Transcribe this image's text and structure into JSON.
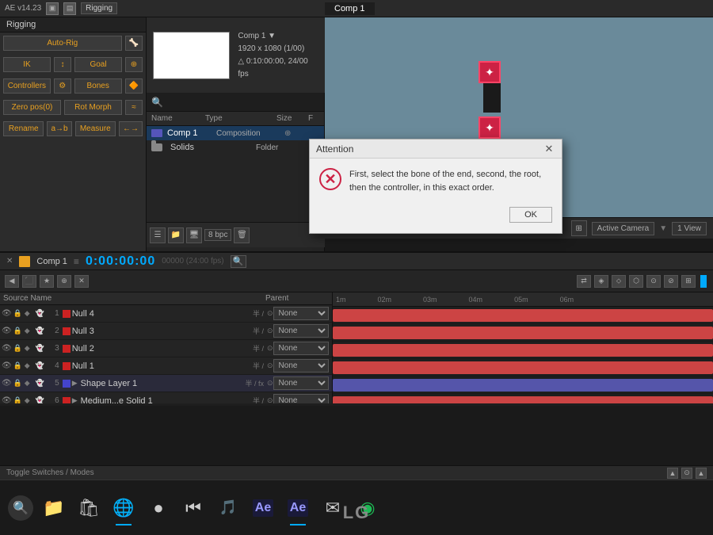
{
  "app": {
    "version": "AE v14.23",
    "mode": "Rigging"
  },
  "topbar": {
    "version_label": "AE v14.23",
    "mode_label": "Rigging"
  },
  "rigging": {
    "auto_rig": "Auto-Rig",
    "ik": "IK",
    "goal": "Goal",
    "controllers": "Controllers",
    "bones": "Bones",
    "zero_pos": "Zero pos(0)",
    "rot_morph": "Rot Morph",
    "rename": "Rename",
    "measure": "Measure"
  },
  "project": {
    "search_placeholder": "🔍",
    "columns": [
      "Name",
      "Type",
      "Size",
      "F"
    ],
    "items": [
      {
        "name": "Comp 1",
        "type": "Composition",
        "color": "#5555bb",
        "icon": "comp"
      },
      {
        "name": "Solids",
        "type": "Folder",
        "color": "#888888",
        "icon": "folder"
      }
    ]
  },
  "comp_info": {
    "name": "Comp 1 ▼",
    "resolution": "1920 x 1080 (1/00)",
    "duration": "△ 0:10:00:00, 24/00 fps"
  },
  "preview_tabs": [
    {
      "label": "Comp 1",
      "active": true
    }
  ],
  "timeline": {
    "comp_name": "Comp 1",
    "timecode": "0:00:00:00",
    "frame_info": "00000 (24:00 fps)",
    "ruler_marks": [
      "1m",
      "02m",
      "03m",
      "04m",
      "05m",
      "06m"
    ],
    "layer_header": [
      "Source Name",
      "Parent"
    ],
    "layers": [
      {
        "num": 1,
        "name": "Null 4",
        "color": "#cc2222",
        "parent": "None",
        "switches": "半 /",
        "type": "null"
      },
      {
        "num": 2,
        "name": "Null 3",
        "color": "#cc2222",
        "parent": "None",
        "switches": "半 /",
        "type": "null"
      },
      {
        "num": 3,
        "name": "Null 2",
        "color": "#cc2222",
        "parent": "None",
        "switches": "半 /",
        "type": "null"
      },
      {
        "num": 4,
        "name": "Null 1",
        "color": "#cc2222",
        "parent": "None",
        "switches": "半 /",
        "type": "null"
      },
      {
        "num": 5,
        "name": "Shape Layer 1",
        "color": "#4444cc",
        "parent": "None",
        "switches": "半 / fx",
        "type": "shape"
      },
      {
        "num": 6,
        "name": "Medium...e Solid 1",
        "color": "#cc2222",
        "parent": "None",
        "switches": "半 /",
        "type": "solid"
      }
    ],
    "track_colors": [
      "#cc4444",
      "#cc4444",
      "#cc4444",
      "#cc4444",
      "#5555aa",
      "#cc4444"
    ]
  },
  "dialog": {
    "title": "Attention",
    "message": "First, select the bone of the end, second, the root, then the controller, in this exact order.",
    "ok_label": "OK"
  },
  "bottom_bar": {
    "toggle_label": "Toggle Switches / Modes"
  },
  "taskbar": {
    "search_icon": "🔍",
    "lg_logo": "LG"
  },
  "view_controls": {
    "camera_label": "Active Camera",
    "view_label": "1 View"
  }
}
